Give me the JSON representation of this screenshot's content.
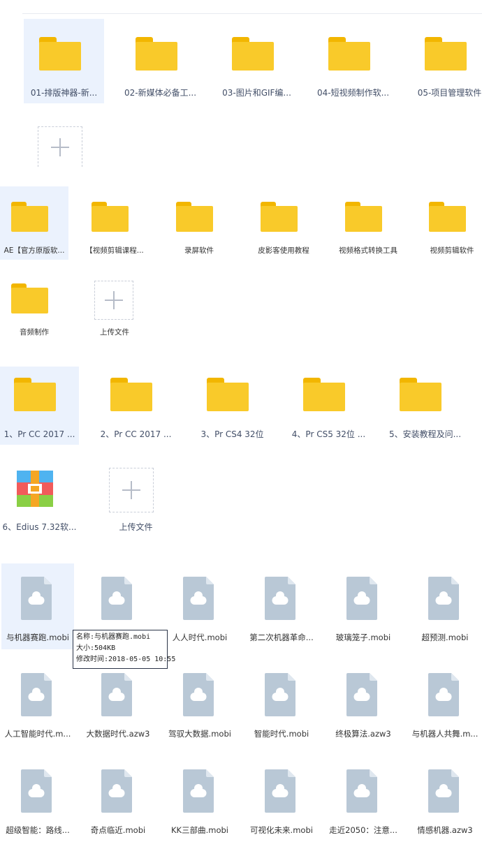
{
  "section1": {
    "folders": [
      "01-排版神器-新...",
      "02-新媒体必备工...",
      "03-图片和GIF编...",
      "04-短视频制作软...",
      "05-项目管理软件"
    ]
  },
  "section2": {
    "folders": [
      "AE【官方原版软...",
      "【视频剪辑课程...",
      "录屏软件",
      "皮影客使用教程",
      "视频格式转换工具",
      "视频剪辑软件",
      "音频制作"
    ],
    "upload_label": "上传文件"
  },
  "section3": {
    "folders": [
      "1、Pr CC 2017 ...",
      "2、Pr CC 2017 ...",
      "3、Pr CS4 32位",
      "4、Pr CS5 32位 ...",
      "5、安装教程及问..."
    ],
    "archive": "6、Edius 7.32软...",
    "upload_label": "上传文件"
  },
  "section4": {
    "files": [
      "与机器赛跑.mobi",
      "",
      "人人时代.mobi",
      "第二次机器革命...",
      "玻璃笼子.mobi",
      "超预测.mobi",
      "人工智能时代.m...",
      "大数据时代.azw3",
      "驾驭大数据.mobi",
      "智能时代.mobi",
      "终极算法.azw3",
      "与机器人共舞.m...",
      "超级智能：路线...",
      "奇点临近.mobi",
      "KK三部曲.mobi",
      "可视化未来.mobi",
      "走近2050：注意...",
      "情感机器.azw3"
    ]
  },
  "tooltip": {
    "line1": "名称:与机器赛跑.mobi",
    "line2": "大小:504KB",
    "line3": "修改时间:2018-05-05 10:55"
  },
  "colors": {
    "folder": "#f9ca2a",
    "folder_tab": "#f2b600",
    "doc": "#b9c8d6",
    "selected_bg": "#ebf2fd"
  }
}
